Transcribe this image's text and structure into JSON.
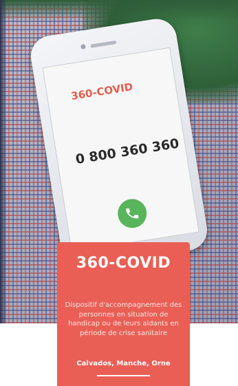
{
  "phone_screen": {
    "brand": "360-COVID",
    "phone_number": "0 800 360 360",
    "call_icon": "phone-call-icon"
  },
  "card": {
    "title": "360-COVID",
    "description": "Dispositif d'accompagnement des personnes en situation de handicap ou de leurs aidants en période de crise sanitaire",
    "regions": "Calvados, Manche, Orne"
  },
  "colors": {
    "accent_red": "#e95f55",
    "call_green": "#58b55b"
  }
}
